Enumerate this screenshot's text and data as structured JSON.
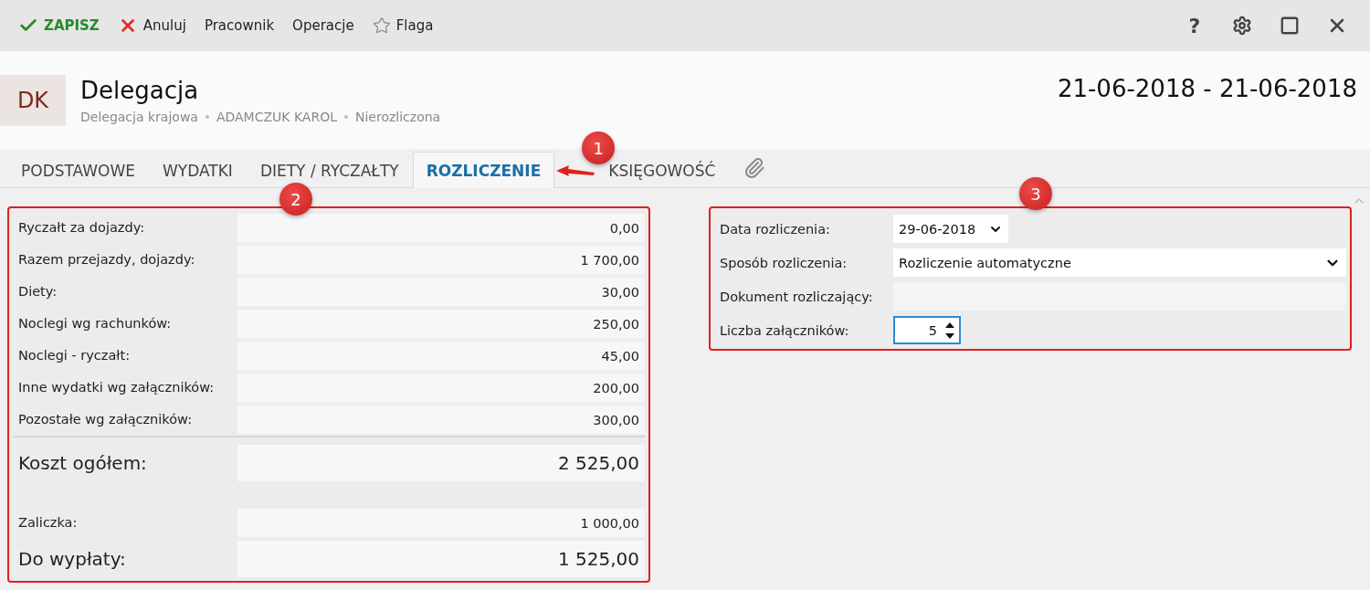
{
  "toolbar": {
    "actions": [
      {
        "kind": "save",
        "label": "ZAPISZ"
      },
      {
        "kind": "cancel",
        "label": "Anuluj"
      },
      {
        "kind": "plain",
        "label": "Pracownik"
      },
      {
        "kind": "plain",
        "label": "Operacje"
      },
      {
        "kind": "flag",
        "label": "Flaga"
      }
    ],
    "window_buttons": [
      {
        "kind": "help",
        "label": "?"
      },
      {
        "kind": "settings"
      },
      {
        "kind": "maximize"
      },
      {
        "kind": "close"
      }
    ]
  },
  "header": {
    "avatar": "DK",
    "title": "Delegacja",
    "subtitle": [
      "Delegacja krajowa",
      "ADAMCZUK KAROL",
      "Nierozliczona"
    ],
    "date_range": "21-06-2018 - 21-06-2018"
  },
  "tabs": [
    {
      "label": "PODSTAWOWE",
      "selected": false
    },
    {
      "label": "WYDATKI",
      "selected": false
    },
    {
      "label": "DIETY / RYCZAŁTY",
      "selected": false
    },
    {
      "label": "ROZLICZENIE",
      "selected": true,
      "callout": "1"
    },
    {
      "label": "KSIĘGOWOŚĆ",
      "selected": false
    }
  ],
  "summary": {
    "callout": "2",
    "rows": [
      {
        "kind": "normal",
        "label": "Ryczałt za dojazdy:",
        "value": "0,00"
      },
      {
        "kind": "normal",
        "label": "Razem przejazdy, dojazdy:",
        "value": "1 700,00"
      },
      {
        "kind": "normal",
        "label": "Diety:",
        "value": "30,00"
      },
      {
        "kind": "normal",
        "label": "Noclegi wg rachunków:",
        "value": "250,00"
      },
      {
        "kind": "normal",
        "label": "Noclegi - ryczałt:",
        "value": "45,00"
      },
      {
        "kind": "normal",
        "label": "Inne wydatki wg załączników:",
        "value": "200,00"
      },
      {
        "kind": "normal",
        "label": "Pozostałe wg załączników:",
        "value": "300,00"
      },
      {
        "kind": "total",
        "label": "Koszt ogółem:",
        "value": "2 525,00"
      },
      {
        "kind": "spacer"
      },
      {
        "kind": "normal",
        "label": "Zaliczka:",
        "value": "1 000,00"
      },
      {
        "kind": "total",
        "label": "Do wypłaty:",
        "value": "1 525,00"
      }
    ]
  },
  "settlement": {
    "callout": "3",
    "fields": [
      {
        "kind": "date",
        "label": "Data rozliczenia:",
        "value": "29-06-2018",
        "focused": false
      },
      {
        "kind": "select",
        "label": "Sposób rozliczenia:",
        "value": "Rozliczenie automatyczne",
        "focused": false
      },
      {
        "kind": "text",
        "label": "Dokument rozliczający:",
        "focused": false
      },
      {
        "kind": "number",
        "label": "Liczba załączników:",
        "value": "5",
        "focused": true
      }
    ]
  }
}
